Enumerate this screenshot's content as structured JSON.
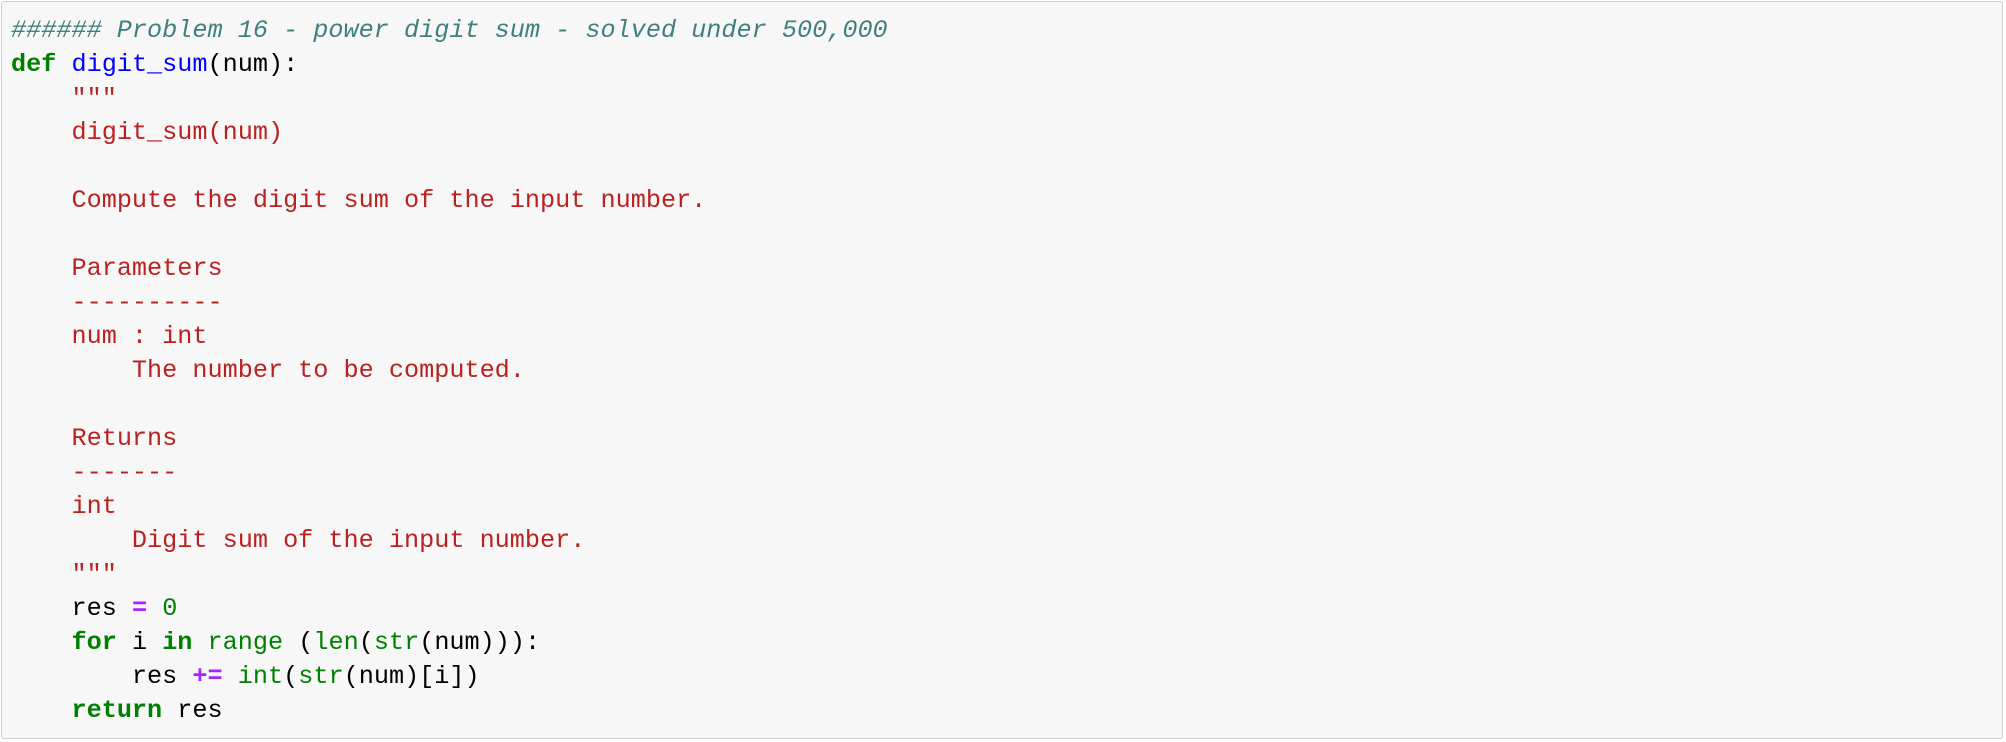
{
  "cell": {
    "background": "#f7f7f7",
    "border_color": "#cfcfcf"
  },
  "colors": {
    "comment": "#408080",
    "keyword": "#008000",
    "function_name": "#0000ff",
    "string": "#ba2121",
    "builtin": "#008000",
    "number": "#008000",
    "operator": "#aa22ff",
    "text": "#000000"
  },
  "code": {
    "l1_comment": "###### Problem 16 - power digit sum - solved under 500,000",
    "l2_def": "def",
    "l2_fname": "digit_sum",
    "l2_rest": "(num):",
    "l3_indent": "    ",
    "l3_quotes": "\"\"\"",
    "l4_indent": "    ",
    "l4_text": "digit_sum(num)",
    "l6_indent": "    ",
    "l6_text": "Compute the digit sum of the input number.",
    "l8_indent": "    ",
    "l8_text": "Parameters",
    "l9_indent": "    ",
    "l9_text": "----------",
    "l10_indent": "    ",
    "l10_text": "num : int",
    "l11_indent": "        ",
    "l11_text": "The number to be computed.",
    "l13_indent": "    ",
    "l13_text": "Returns",
    "l14_indent": "    ",
    "l14_text": "-------",
    "l15_indent": "    ",
    "l15_text": "int",
    "l16_indent": "        ",
    "l16_text": "Digit sum of the input number.",
    "l17_indent": "    ",
    "l17_quotes": "\"\"\"",
    "l18_indent": "    ",
    "l18_var": "res",
    "l18_sp1": " ",
    "l18_op": "=",
    "l18_sp2": " ",
    "l18_num": "0",
    "l19_indent": "    ",
    "l19_for": "for",
    "l19_i": " i ",
    "l19_in": "in",
    "l19_sp": " ",
    "l19_range": "range",
    "l19_paren1": " (",
    "l19_len": "len",
    "l19_paren2": "(",
    "l19_str": "str",
    "l19_rest": "(num))):",
    "l20_indent": "        ",
    "l20_var": "res",
    "l20_sp1": " ",
    "l20_op": "+=",
    "l20_sp2": " ",
    "l20_int": "int",
    "l20_paren": "(",
    "l20_str": "str",
    "l20_rest": "(num)[i])",
    "l21_indent": "    ",
    "l21_return": "return",
    "l21_rest": " res"
  }
}
